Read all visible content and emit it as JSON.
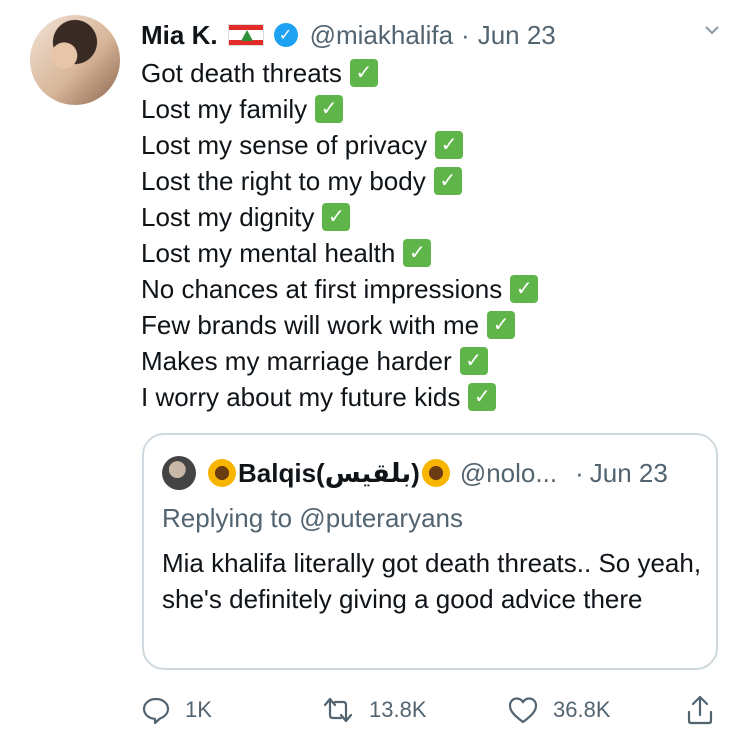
{
  "tweet": {
    "name": "Mia K.",
    "handle": "@miakhalifa",
    "separator": "·",
    "date": "Jun 23",
    "lines": [
      "Got death threats",
      "Lost my family",
      "Lost my sense of privacy",
      "Lost the right to my body",
      "Lost my dignity",
      "Lost my mental health",
      "No chances at first impressions",
      "Few brands will work with me",
      "Makes my marriage harder",
      "I worry about my future kids"
    ],
    "check_glyph": "✓"
  },
  "quote": {
    "name": "Balqis(بلقيس)",
    "handle": "@nolo...",
    "separator": "·",
    "date": "Jun 23",
    "replying_to": "Replying to @puteraryans",
    "text": "Mia khalifa literally got death threats.. So yeah, she's definitely giving a good advice there"
  },
  "actions": {
    "reply_count": "1K",
    "retweet_count": "13.8K",
    "like_count": "36.8K"
  },
  "icons": {
    "flag": "lebanon-flag-icon",
    "verified": "verified-badge-icon",
    "check": "white-check-mark-icon",
    "sunflower": "sunflower-icon",
    "chevron": "chevron-down-icon",
    "reply": "reply-icon",
    "retweet": "retweet-icon",
    "like": "heart-icon",
    "share": "share-icon"
  },
  "colors": {
    "verified": "#1da1f2",
    "check_bg": "#5fb44a",
    "muted_text": "#536471",
    "border": "#cfd9de"
  }
}
